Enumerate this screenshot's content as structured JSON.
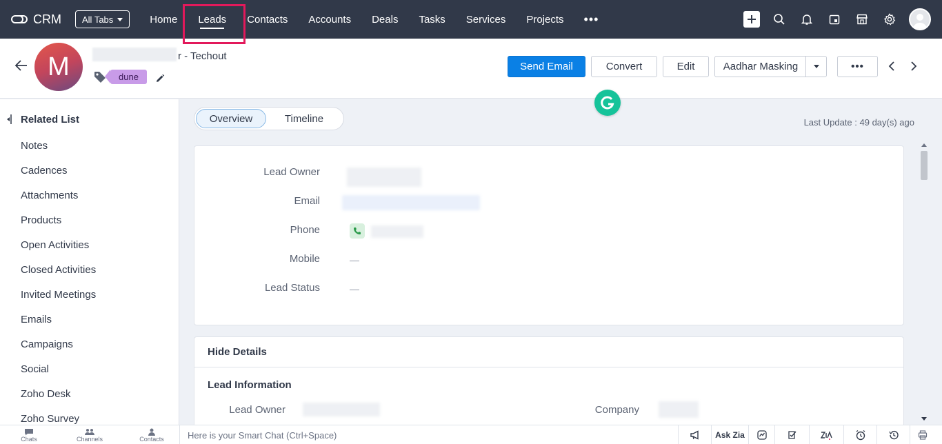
{
  "topbar": {
    "app_name": "CRM",
    "all_tabs_label": "All Tabs",
    "nav": [
      "Home",
      "Leads",
      "Contacts",
      "Accounts",
      "Deals",
      "Tasks",
      "Services",
      "Projects"
    ],
    "active_tab": "Leads",
    "more_label": "•••",
    "icons": [
      "plus-icon",
      "search-icon",
      "bell-icon",
      "calendar-icon",
      "store-icon",
      "gear-icon",
      "avatar"
    ]
  },
  "record": {
    "avatar_letter": "M",
    "name_suffix": "r",
    "company_suffix": " - Techout",
    "tag": "dune",
    "buttons": {
      "send_email": "Send Email",
      "convert": "Convert",
      "edit": "Edit",
      "aadhar": "Aadhar Masking",
      "more": "•••"
    }
  },
  "sidebar": {
    "title": "Related List",
    "items": [
      "Notes",
      "Cadences",
      "Attachments",
      "Products",
      "Open Activities",
      "Closed Activities",
      "Invited Meetings",
      "Emails",
      "Campaigns",
      "Social",
      "Zoho Desk",
      "Zoho Survey"
    ]
  },
  "main": {
    "tabs": [
      "Overview",
      "Timeline"
    ],
    "active_tab": "Overview",
    "last_update": "Last Update : 49 day(s) ago",
    "summary_fields": [
      {
        "label": "Lead Owner",
        "value": ""
      },
      {
        "label": "Email",
        "value": ""
      },
      {
        "label": "Phone",
        "value": ""
      },
      {
        "label": "Mobile",
        "value": "—"
      },
      {
        "label": "Lead Status",
        "value": "—"
      }
    ],
    "hide_details": "Hide Details",
    "lead_information": "Lead Information",
    "detail_fields": [
      {
        "label": "Lead Owner",
        "value": ""
      },
      {
        "label": "Company",
        "value": ""
      }
    ]
  },
  "bottombar": {
    "left": [
      "Chats",
      "Channels",
      "Contacts"
    ],
    "smart_chat_placeholder": "Here is your Smart Chat (Ctrl+Space)",
    "ask_zia": "Ask Zia"
  },
  "colors": {
    "topbar": "#313949",
    "primary": "#0a80e5",
    "highlight": "#e2195b",
    "tag": "#c89be8"
  }
}
